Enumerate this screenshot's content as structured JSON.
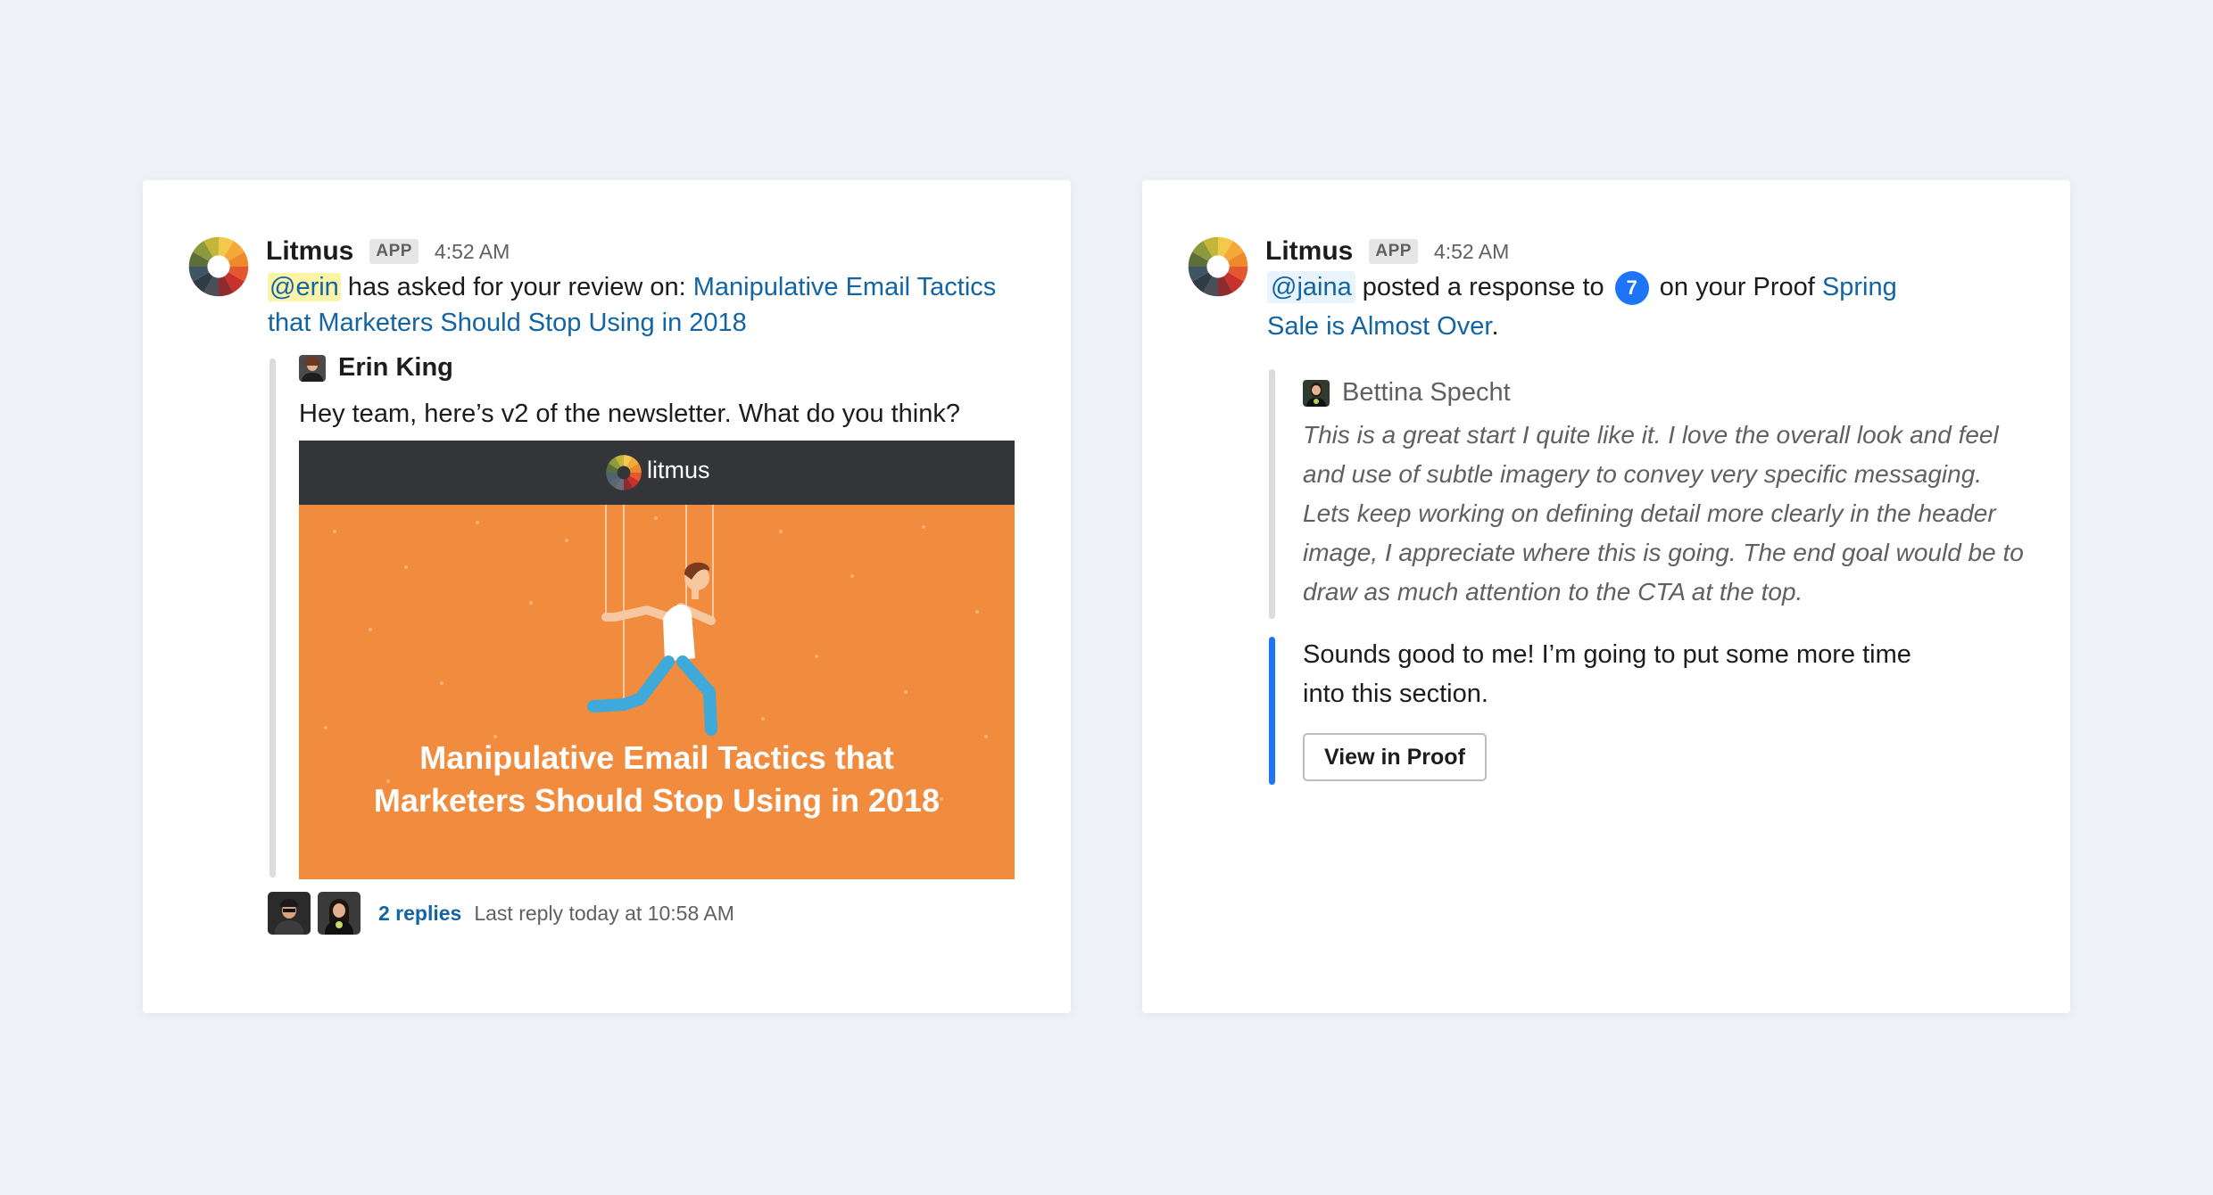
{
  "colors": {
    "background": "#eef2f6",
    "link": "#1264a3",
    "quote_bar": "#dcdcdc",
    "reply_bar": "#1d74f5",
    "preview_header": "#333538",
    "preview_body": "#f18b3e"
  },
  "cards": [
    {
      "app_name": "Litmus",
      "badge": "APP",
      "time": "4:52 AM",
      "message": {
        "mention": "@erin",
        "text": " has asked for your review on: ",
        "link": "Manipulative Email Tactics that Marketers Should Stop Using in 2018"
      },
      "attachment": {
        "author": "Erin King",
        "text": "Hey team, here’s v2 of the newsletter. What do you think?",
        "preview": {
          "brand": "litmus",
          "title_line1": "Manipulative Email Tactics that",
          "title_line2": "Marketers Should Stop Using in 2018"
        }
      },
      "thread": {
        "replies": "2 replies",
        "last_reply": "Last reply today at 10:58 AM"
      }
    },
    {
      "app_name": "Litmus",
      "badge": "APP",
      "time": "4:52 AM",
      "message": {
        "mention": "@jaina",
        "text1": " posted a response to ",
        "count": "7",
        "text2": " on your Proof ",
        "link": "Spring Sale is Almost Over",
        "end": "."
      },
      "quote": {
        "author": "Bettina Specht",
        "text": "This is a great start I quite like it. I love the overall look and feel and use of subtle imagery to convey very specific messaging. Lets keep working on defining detail more clearly in the header image, I appreciate where this is going. The end goal would be to draw as much attention to the CTA at the top."
      },
      "reply": {
        "text": "Sounds good to me! I’m going to put some more time into this section.",
        "button": "View in Proof"
      }
    }
  ]
}
